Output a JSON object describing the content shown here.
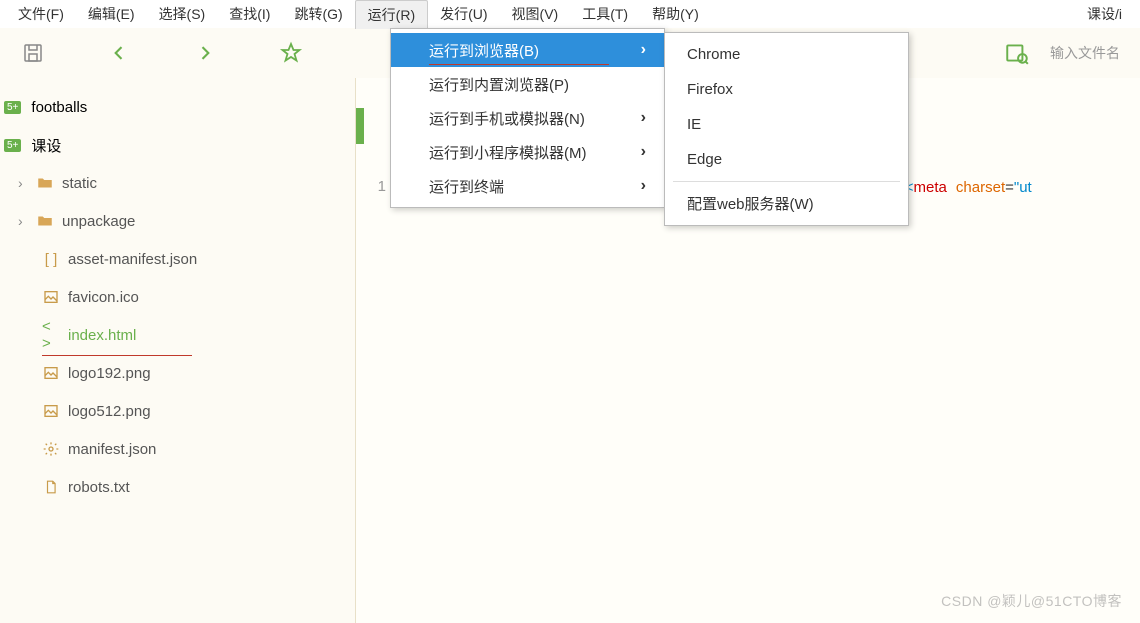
{
  "menubar": {
    "items": [
      "文件(F)",
      "编辑(E)",
      "选择(S)",
      "查找(I)",
      "跳转(G)",
      "运行(R)",
      "发行(U)",
      "视图(V)",
      "工具(T)",
      "帮助(Y)"
    ],
    "active_index": 5,
    "right": "课设/i"
  },
  "toolbar": {
    "search_placeholder": "输入文件名"
  },
  "sidebar": {
    "projects": [
      {
        "badge": "5+",
        "name": "footballs"
      },
      {
        "badge": "5+",
        "name": "课设"
      }
    ],
    "tree": [
      {
        "type": "folder",
        "name": "static",
        "expanded": false
      },
      {
        "type": "folder",
        "name": "unpackage",
        "expanded": false
      },
      {
        "type": "file",
        "name": "asset-manifest.json",
        "icon": "braces"
      },
      {
        "type": "file",
        "name": "favicon.ico",
        "icon": "image"
      },
      {
        "type": "file",
        "name": "index.html",
        "icon": "code",
        "selected": true
      },
      {
        "type": "file",
        "name": "logo192.png",
        "icon": "image"
      },
      {
        "type": "file",
        "name": "logo512.png",
        "icon": "image"
      },
      {
        "type": "file",
        "name": "manifest.json",
        "icon": "gear"
      },
      {
        "type": "file",
        "name": "robots.txt",
        "icon": "doc"
      }
    ]
  },
  "dropdown1": {
    "items": [
      {
        "label": "运行到浏览器(B)",
        "arrow": true,
        "highlight": true
      },
      {
        "label": "运行到内置浏览器(P)",
        "arrow": false
      },
      {
        "label": "运行到手机或模拟器(N)",
        "arrow": true
      },
      {
        "label": "运行到小程序模拟器(M)",
        "arrow": true
      },
      {
        "label": "运行到终端",
        "arrow": true
      }
    ]
  },
  "dropdown2": {
    "items": [
      "Chrome",
      "Firefox",
      "IE",
      "Edge"
    ],
    "footer": "配置web服务器(W)"
  },
  "editor": {
    "line_number": "1",
    "code_visible": {
      "angle": ">",
      "lt": "<",
      "tag": "meta",
      "attr": "charset",
      "eq": "=",
      "str": "\"ut"
    }
  },
  "watermark": "CSDN @颖儿@51CTO博客"
}
